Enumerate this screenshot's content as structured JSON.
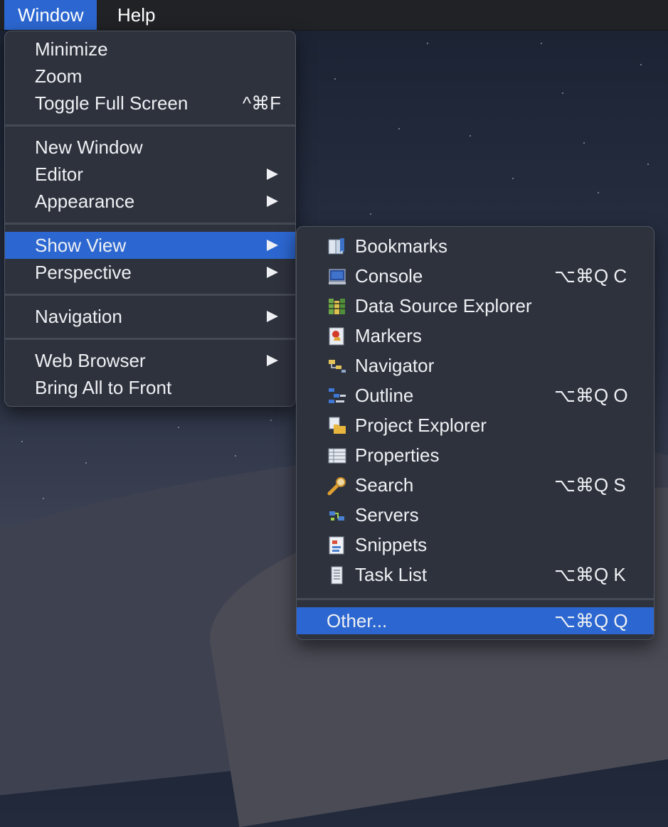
{
  "menubar": {
    "items": [
      "Window",
      "Help"
    ]
  },
  "window_menu": {
    "groups": [
      [
        {
          "label": "Minimize"
        },
        {
          "label": "Zoom"
        },
        {
          "label": "Toggle Full Screen",
          "shortcut": "^⌘F"
        }
      ],
      [
        {
          "label": "New Window"
        },
        {
          "label": "Editor"
        },
        {
          "label": "Appearance"
        }
      ],
      [
        {
          "label": "Show View"
        },
        {
          "label": "Perspective"
        }
      ],
      [
        {
          "label": "Navigation"
        }
      ],
      [
        {
          "label": "Web Browser"
        },
        {
          "label": "Bring All to Front"
        }
      ]
    ]
  },
  "show_view_menu": {
    "items": [
      {
        "label": "Bookmarks",
        "icon": "bookmarks-icon"
      },
      {
        "label": "Console",
        "icon": "console-icon",
        "shortcut": "⌥⌘Q C"
      },
      {
        "label": "Data Source Explorer",
        "icon": "data-source-explorer-icon"
      },
      {
        "label": "Markers",
        "icon": "markers-icon"
      },
      {
        "label": "Navigator",
        "icon": "navigator-icon"
      },
      {
        "label": "Outline",
        "icon": "outline-icon",
        "shortcut": "⌥⌘Q O"
      },
      {
        "label": "Project Explorer",
        "icon": "project-explorer-icon"
      },
      {
        "label": "Properties",
        "icon": "properties-icon"
      },
      {
        "label": "Search",
        "icon": "search-icon",
        "shortcut": "⌥⌘Q S"
      },
      {
        "label": "Servers",
        "icon": "servers-icon"
      },
      {
        "label": "Snippets",
        "icon": "snippets-icon"
      },
      {
        "label": "Task List",
        "icon": "task-list-icon",
        "shortcut": "⌥⌘Q K"
      }
    ],
    "other": {
      "label": "Other...",
      "shortcut": "⌥⌘Q Q"
    }
  },
  "colors": {
    "highlight": "#2c67d1",
    "menu_bg": "#2e323d",
    "menubar_bg": "#202226"
  }
}
